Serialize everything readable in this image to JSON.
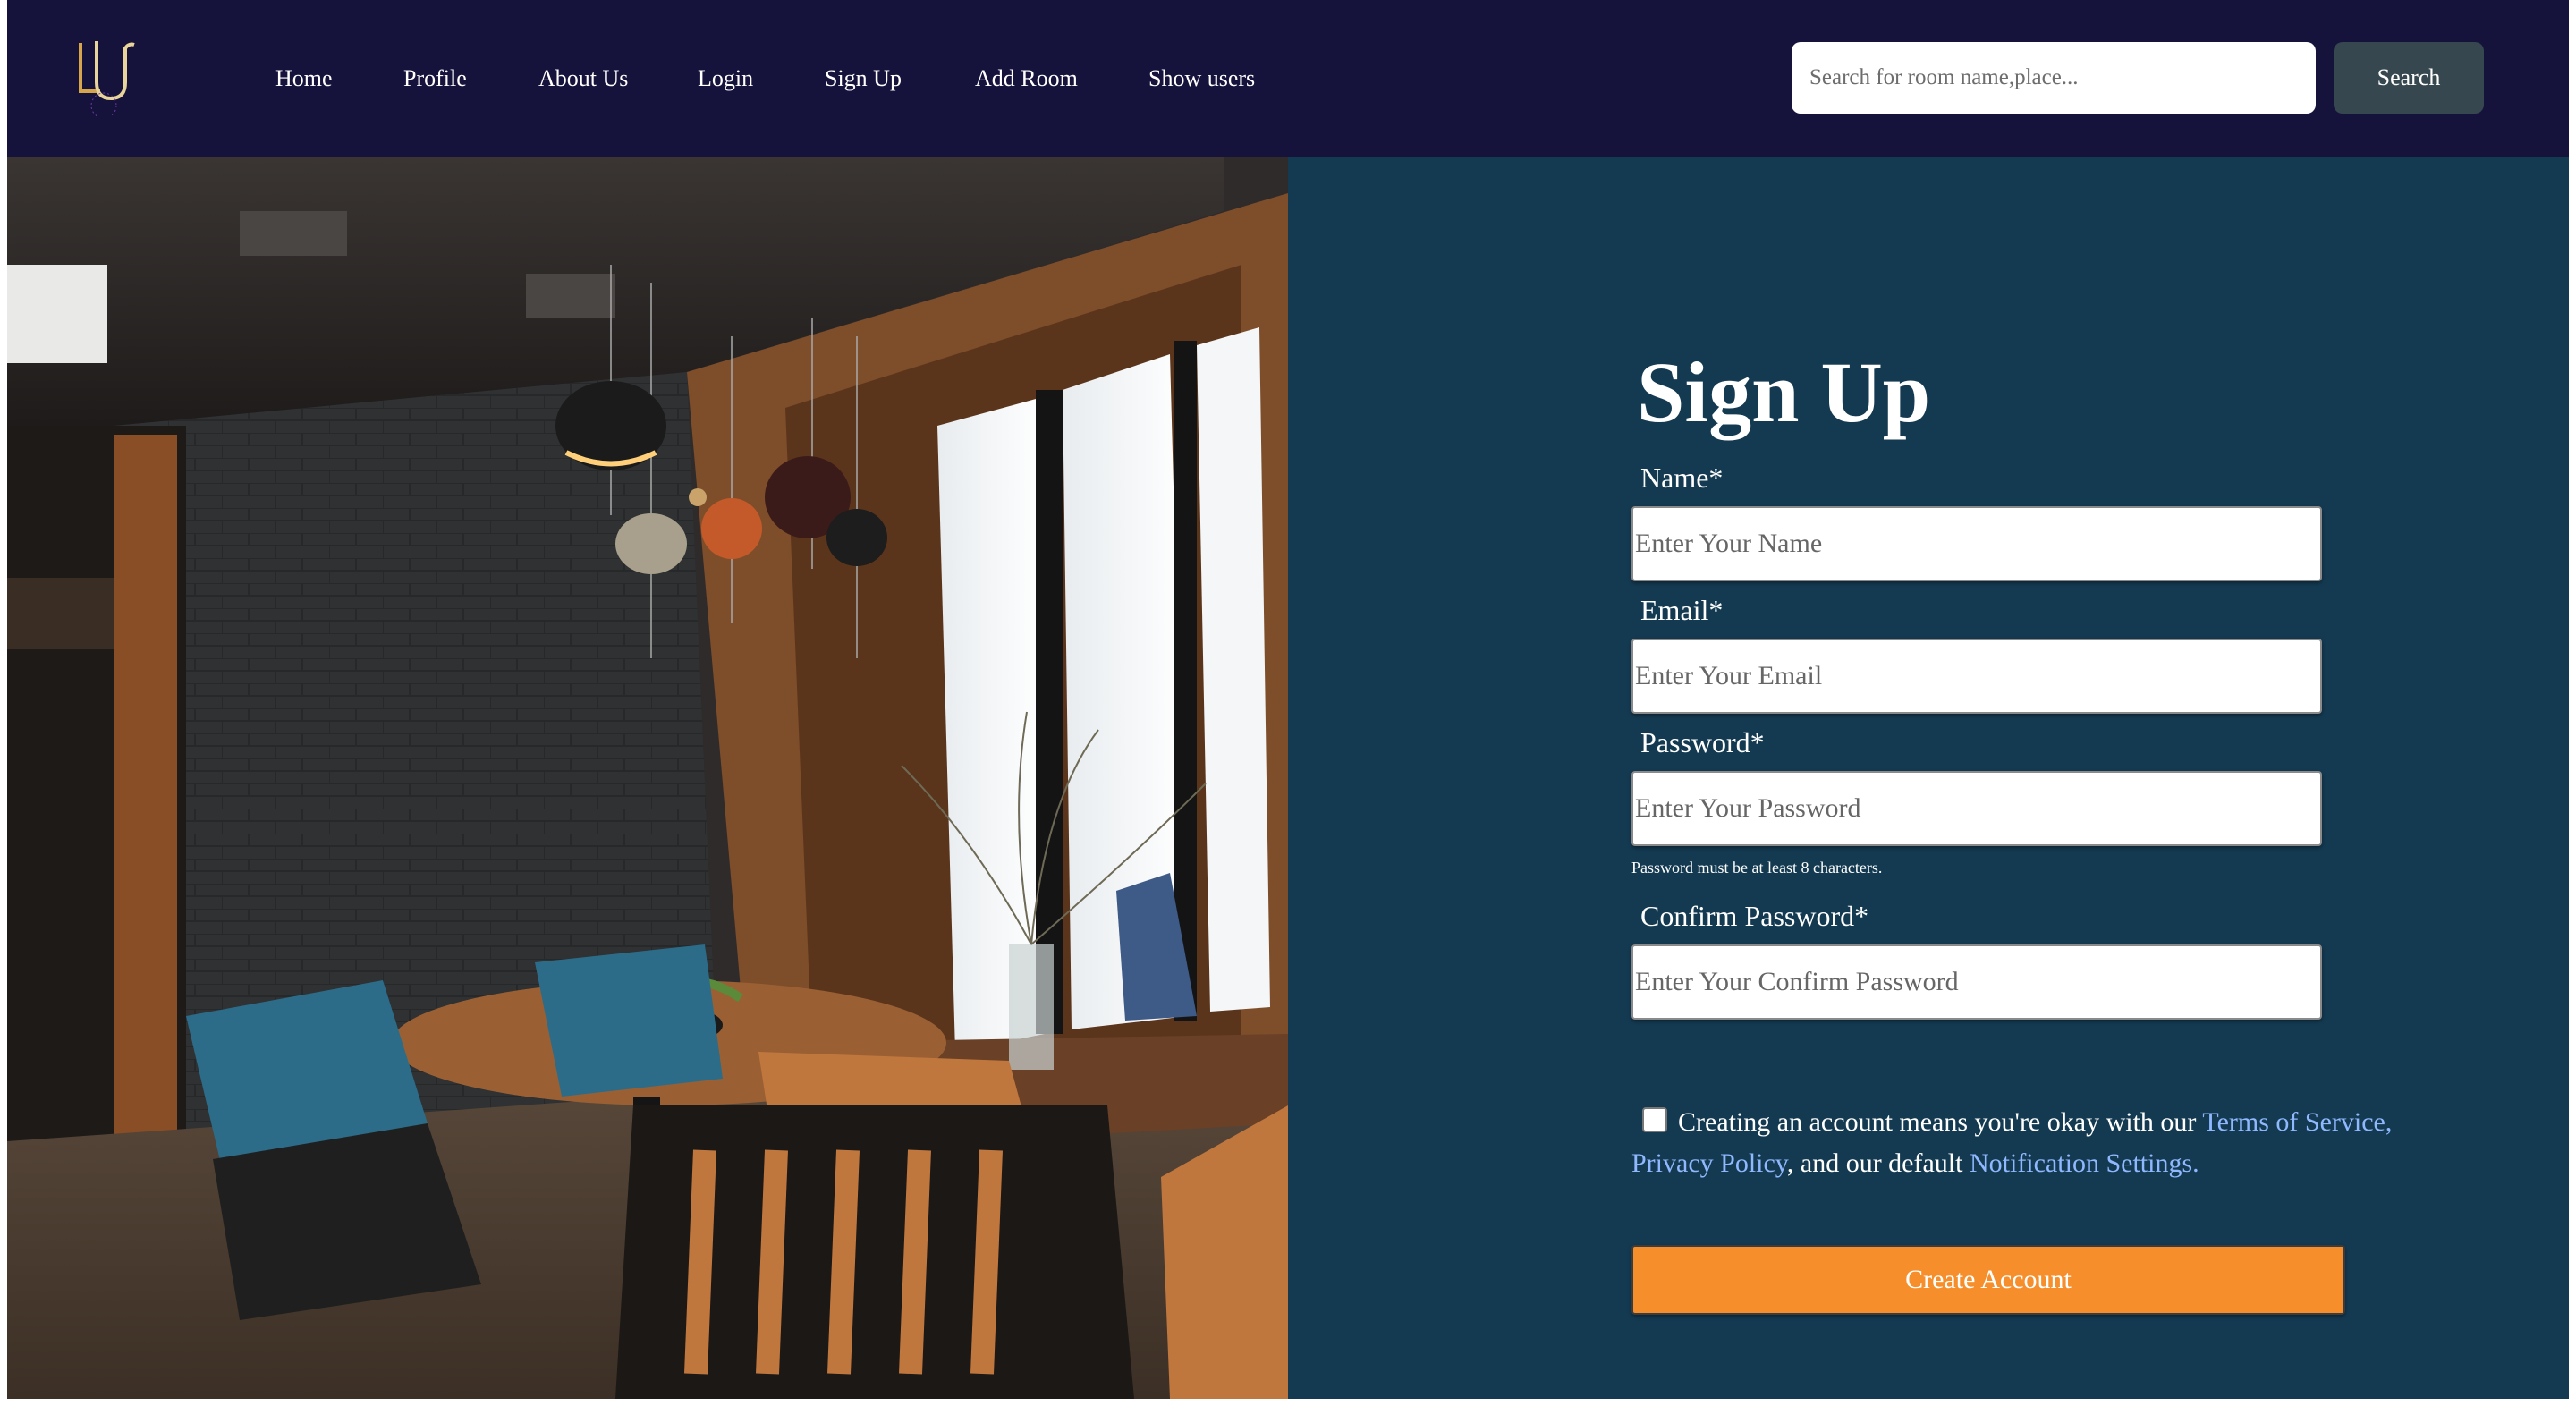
{
  "nav": {
    "logo_text": "LU",
    "links": [
      "Home",
      "Profile",
      "About Us",
      "Login",
      "Sign Up",
      "Add Room",
      "Show users"
    ],
    "search_placeholder": "Search for room name,place...",
    "search_button": "Search"
  },
  "form": {
    "title": "Sign Up",
    "fields": [
      {
        "label": "Name*",
        "placeholder": "Enter Your Name"
      },
      {
        "label": "Email*",
        "placeholder": "Enter Your Email"
      },
      {
        "label": "Password*",
        "placeholder": "Enter Your Password"
      },
      {
        "label": "Confirm Password*",
        "placeholder": "Enter Your Confirm Password"
      }
    ],
    "password_hint": "Password must be at least 8 characters.",
    "consent": {
      "text_before": "Creating an account means you're okay with our ",
      "terms": "Terms of Service,",
      "privacy": "Privacy Policy",
      "text_middle": ", and our default ",
      "notifications": "Notification Settings."
    },
    "submit": "Create Account"
  },
  "colors": {
    "navbar": "#15123c",
    "form_panel": "#143a52",
    "search_button": "#37474f",
    "submit_button": "#f68f2b",
    "link": "#8fb8ff",
    "logo_gold": "#d7a64a"
  }
}
